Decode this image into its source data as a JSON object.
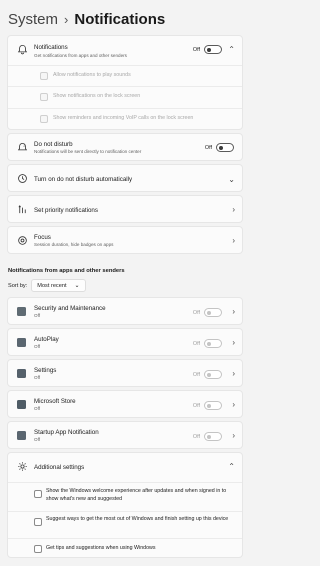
{
  "breadcrumb": {
    "parent": "System",
    "separator": "›",
    "current": "Notifications"
  },
  "notifications": {
    "title": "Notifications",
    "subtitle": "Get notifications from apps and other senders",
    "state": "Off",
    "options": [
      "Allow notifications to play sounds",
      "Show notifications on the lock screen",
      "Show reminders and incoming VoIP calls on the lock screen"
    ]
  },
  "dnd": {
    "title": "Do not disturb",
    "subtitle": "Notifications will be sent directly to notification center",
    "state": "Off"
  },
  "auto_dnd": {
    "title": "Turn on do not disturb automatically"
  },
  "priority": {
    "title": "Set priority notifications"
  },
  "focus": {
    "title": "Focus",
    "subtitle": "Session duration, hide badges on apps"
  },
  "senders": {
    "heading": "Notifications from apps and other senders",
    "sort_label": "Sort by:",
    "sort_value": "Most recent",
    "apps": [
      {
        "name": "Security and Maintenance",
        "status": "Off",
        "state": "Off"
      },
      {
        "name": "AutoPlay",
        "status": "Off",
        "state": "Off"
      },
      {
        "name": "Settings",
        "status": "Off",
        "state": "Off"
      },
      {
        "name": "Microsoft Store",
        "status": "Off",
        "state": "Off"
      },
      {
        "name": "Startup App Notification",
        "status": "Off",
        "state": "Off"
      }
    ]
  },
  "additional": {
    "title": "Additional settings",
    "options": [
      "Show the Windows welcome experience after updates and when signed in to show what's new and suggested",
      "Suggest ways to get the most out of Windows and finish setting up this device",
      "Get tips and suggestions when using Windows"
    ]
  }
}
